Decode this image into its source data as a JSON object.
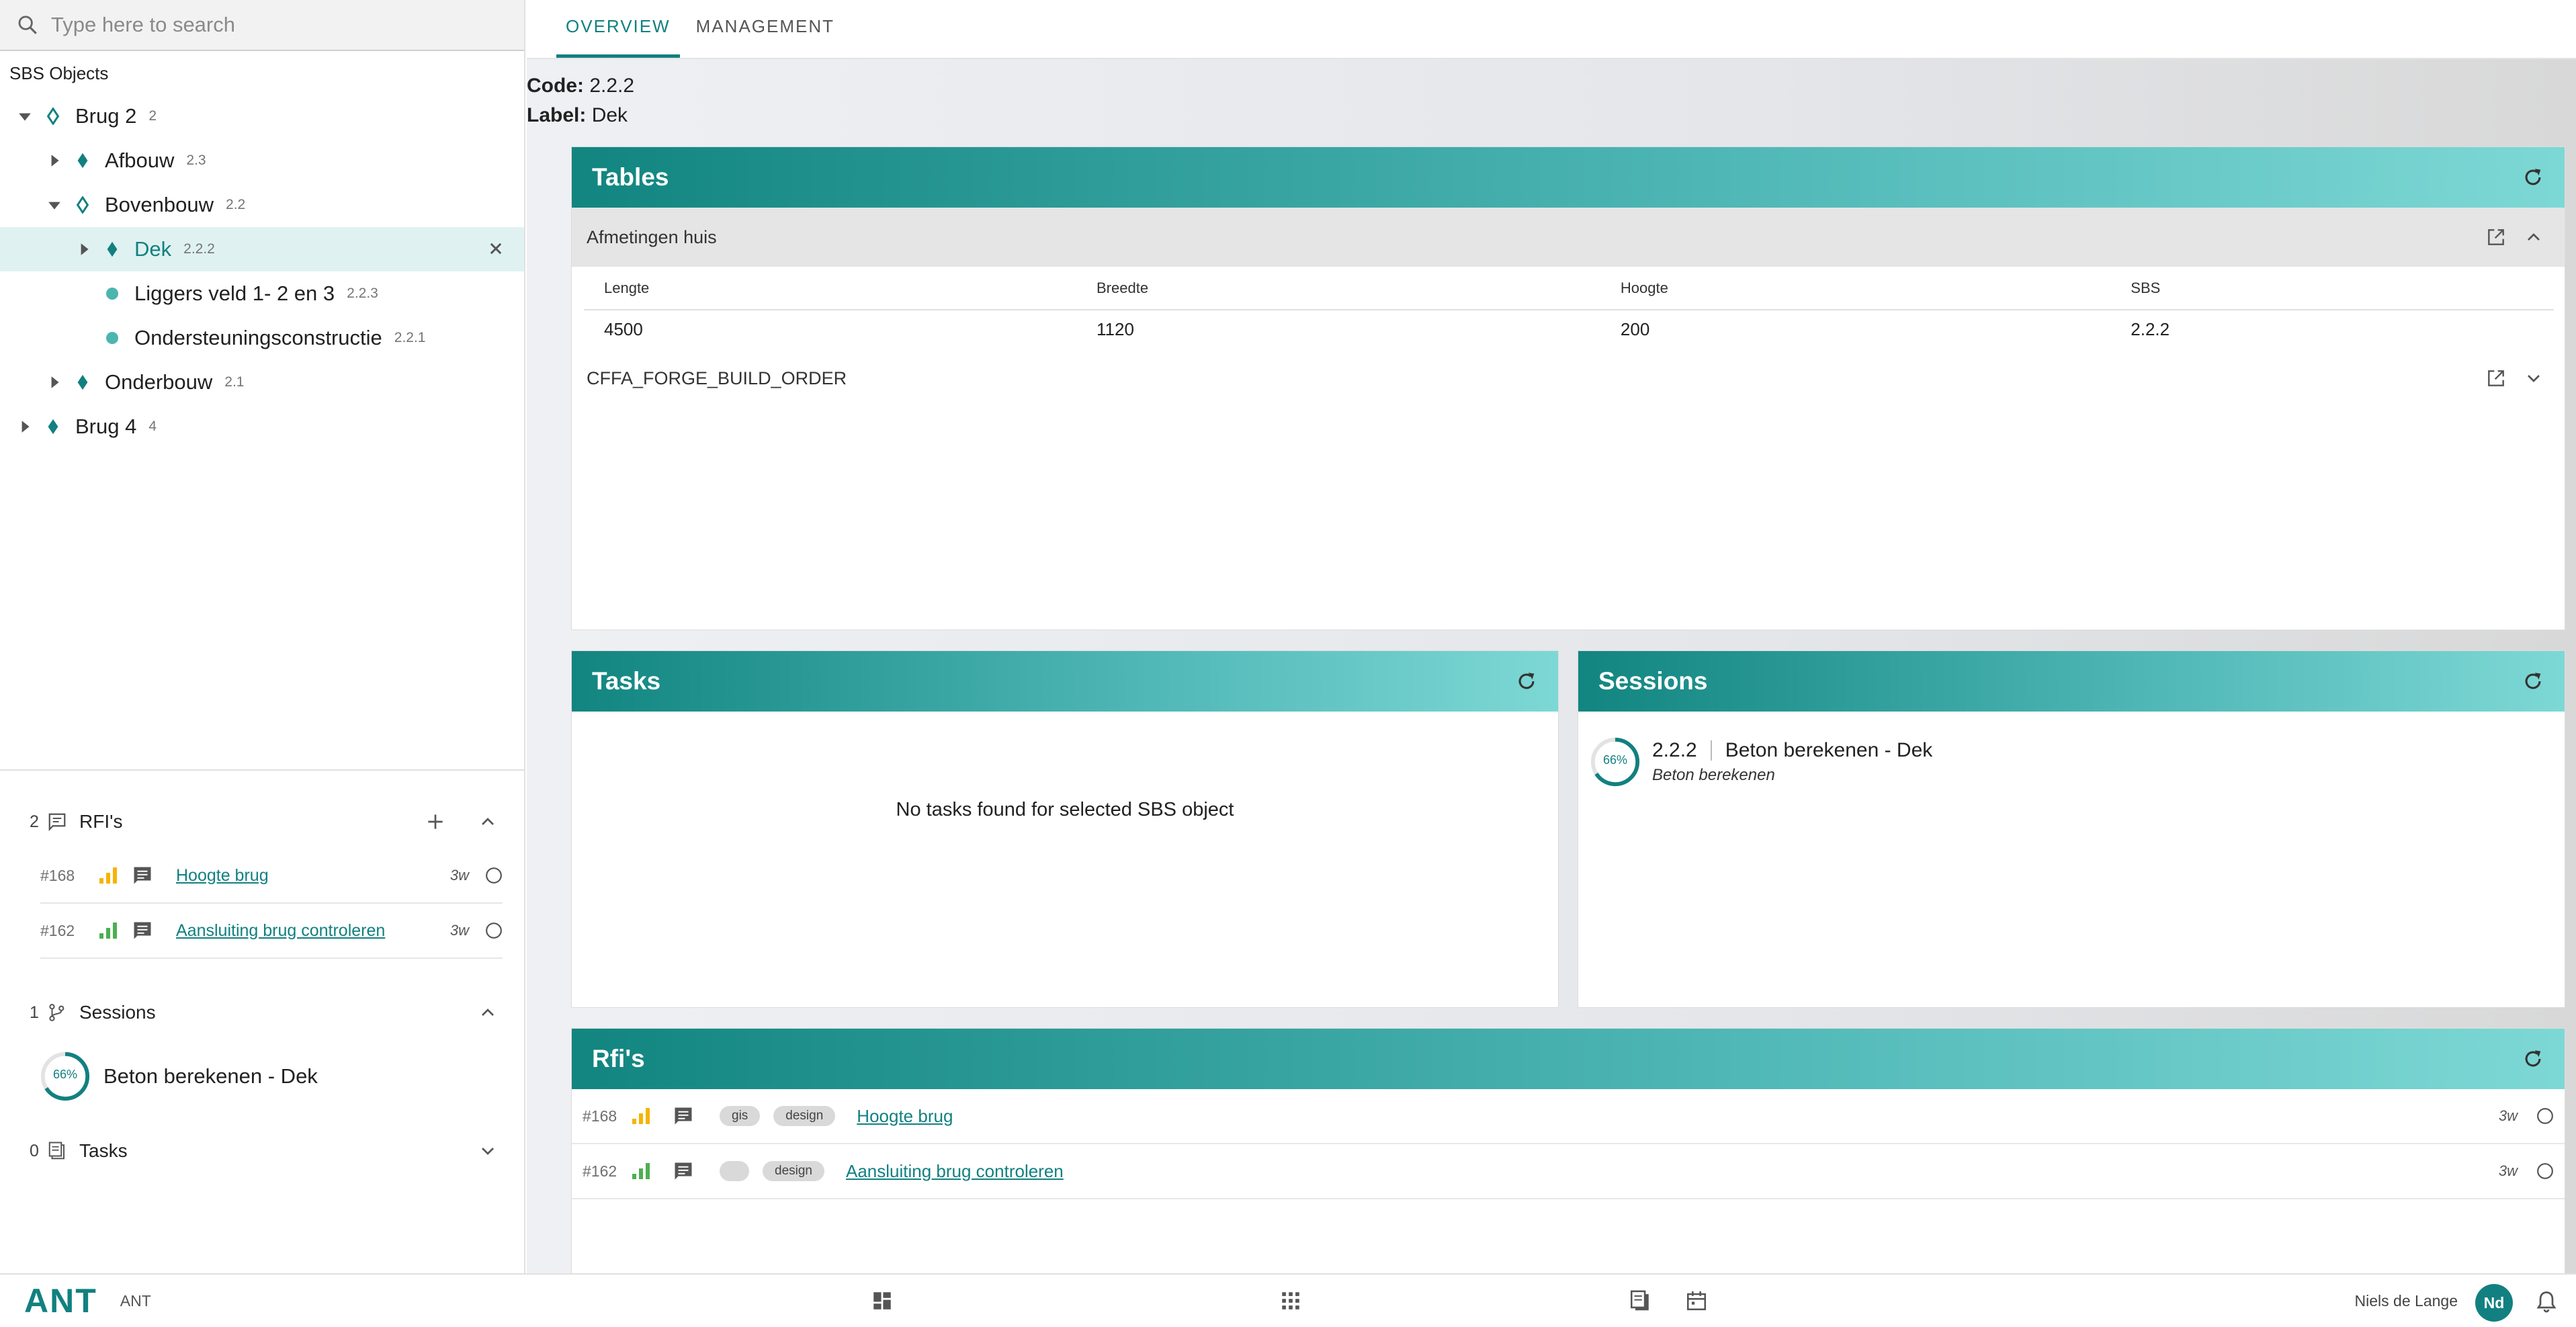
{
  "search": {
    "placeholder": "Type here to search"
  },
  "sbs": {
    "header": "SBS Objects",
    "tree": [
      {
        "label": "Brug 2",
        "code": "2"
      },
      {
        "label": "Afbouw",
        "code": "2.3"
      },
      {
        "label": "Bovenbouw",
        "code": "2.2"
      },
      {
        "label": "Dek",
        "code": "2.2.2"
      },
      {
        "label": "Liggers veld 1- 2 en 3",
        "code": "2.2.3"
      },
      {
        "label": "Ondersteuningsconstructie",
        "code": "2.2.1"
      },
      {
        "label": "Onderbouw",
        "code": "2.1"
      },
      {
        "label": "Brug 4",
        "code": "4"
      }
    ]
  },
  "left_sections": {
    "rfis": {
      "count": "2",
      "title": "RFI's",
      "items": [
        {
          "num": "#168",
          "title": "Hoogte brug",
          "age": "3w"
        },
        {
          "num": "#162",
          "title": "Aansluiting brug controleren",
          "age": "3w"
        }
      ]
    },
    "sessions": {
      "count": "1",
      "title": "Sessions",
      "items": [
        {
          "progress": "66%",
          "label": "Beton berekenen - Dek"
        }
      ]
    },
    "tasks": {
      "count": "0",
      "title": "Tasks"
    }
  },
  "tabs": [
    {
      "label": "OVERVIEW"
    },
    {
      "label": "MANAGEMENT"
    }
  ],
  "meta": {
    "code_label": "Code:",
    "code_value": "2.2.2",
    "label_label": "Label:",
    "label_value": "Dek"
  },
  "tables_card": {
    "title": "Tables",
    "groups": [
      {
        "name": "Afmetingen huis",
        "columns": [
          "Lengte",
          "Breedte",
          "Hoogte",
          "SBS"
        ],
        "rows": [
          [
            "4500",
            "1120",
            "200",
            "2.2.2"
          ]
        ]
      },
      {
        "name": "CFFA_FORGE_BUILD_ORDER"
      }
    ]
  },
  "tasks_card": {
    "title": "Tasks",
    "empty": "No tasks found for selected SBS object"
  },
  "sessions_card": {
    "title": "Sessions",
    "items": [
      {
        "progress": "66%",
        "code": "2.2.2",
        "title": "Beton berekenen - Dek",
        "subtitle": "Beton berekenen"
      }
    ]
  },
  "rfis_card": {
    "title": "Rfi's",
    "items": [
      {
        "num": "#168",
        "chip1": "gis",
        "chip2": "design",
        "title": "Hoogte brug",
        "age": "3w"
      },
      {
        "num": "#162",
        "chip1": "",
        "chip2": "design",
        "title": "Aansluiting brug controleren",
        "age": "3w"
      }
    ]
  },
  "bottombar": {
    "logo": "ANT",
    "app_name": "ANT",
    "user_name": "Niels de Lange",
    "user_initials": "Nd"
  },
  "colors": {
    "accent": "#128080",
    "priority_high": "#f5b400",
    "priority_low": "#4caf50"
  },
  "icons": [
    "search-icon",
    "chevron-down-icon",
    "chevron-right-icon",
    "diamond-outline-icon",
    "diamond-icon",
    "dot-icon",
    "close-icon",
    "comment-icon",
    "plus-icon",
    "chevron-up-icon",
    "branch-icon",
    "clipboard-icon",
    "refresh-icon",
    "open-external-icon",
    "dashboard-icon",
    "apps-grid-icon",
    "calendar-icon",
    "bell-icon"
  ]
}
